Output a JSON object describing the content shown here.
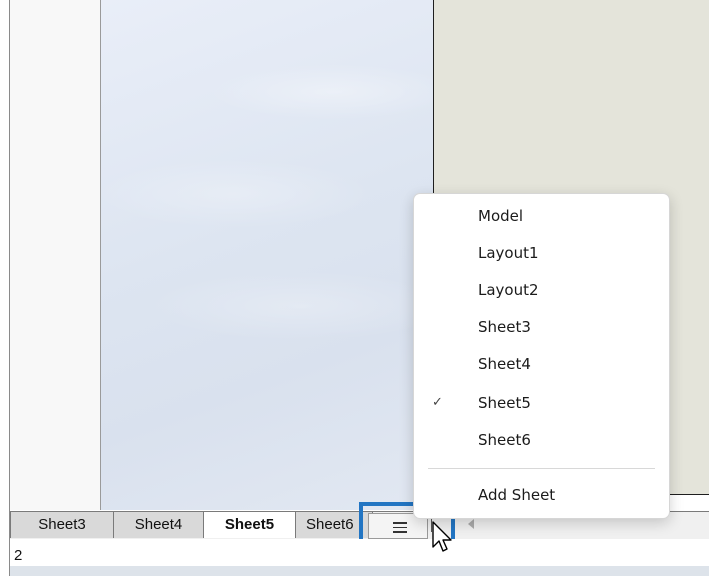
{
  "sheet_tabs": [
    {
      "label": "Sheet3",
      "active": false
    },
    {
      "label": "Sheet4",
      "active": false
    },
    {
      "label": "Sheet5",
      "active": true
    },
    {
      "label": "Sheet6",
      "active": false
    }
  ],
  "tab_list_button": {
    "icon": "hamburger-icon"
  },
  "tab_scroll": {
    "icon": "triangle-left-icon"
  },
  "status": {
    "value": "2"
  },
  "menu": {
    "items": [
      {
        "label": "Model",
        "checked": false
      },
      {
        "label": "Layout1",
        "checked": false
      },
      {
        "label": "Layout2",
        "checked": false
      },
      {
        "label": "Sheet3",
        "checked": false
      },
      {
        "label": "Sheet4",
        "checked": false
      },
      {
        "label": "Sheet5",
        "checked": true
      },
      {
        "label": "Sheet6",
        "checked": false
      }
    ],
    "add_label": "Add Sheet",
    "check_glyph": "✓"
  },
  "colors": {
    "highlight": "#2275c3",
    "paper": "#e4e4da",
    "canvas": "#dde5f1"
  }
}
